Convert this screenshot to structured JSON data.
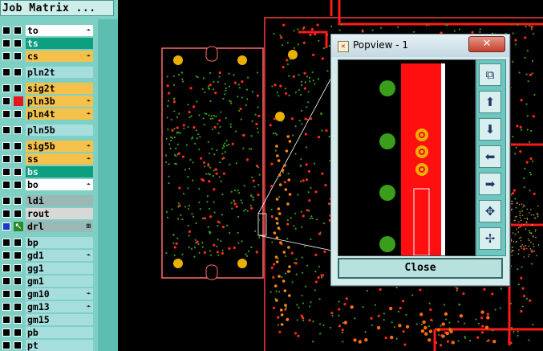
{
  "panel": {
    "title": "Job Matrix ..."
  },
  "layers": [
    {
      "name": "to",
      "color": "white",
      "mark": "⌁"
    },
    {
      "name": "ts",
      "color": "teal",
      "mark": ""
    },
    {
      "name": "cs",
      "color": "orange",
      "mark": "⌁"
    },
    {
      "name": "pln2t",
      "color": "cyan",
      "mark": ""
    },
    {
      "name": "sig2t",
      "color": "orange",
      "mark": ""
    },
    {
      "name": "pln3b",
      "color": "orange",
      "mark": "⌁",
      "active": true
    },
    {
      "name": "pln4t",
      "color": "orange",
      "mark": "⌁"
    },
    {
      "name": "pln5b",
      "color": "cyan",
      "mark": ""
    },
    {
      "name": "sig5b",
      "color": "orange",
      "mark": "⌁"
    },
    {
      "name": "ss",
      "color": "orange",
      "mark": "⌁"
    },
    {
      "name": "bs",
      "color": "teal",
      "mark": ""
    },
    {
      "name": "bo",
      "color": "white",
      "mark": "⌁"
    },
    {
      "name": "ldi",
      "color": "slate",
      "mark": ""
    },
    {
      "name": "rout",
      "color": "grey",
      "mark": ""
    },
    {
      "name": "drl",
      "color": "slate",
      "mark": "⊞",
      "selected": true
    },
    {
      "name": "bp",
      "color": "cyan",
      "mark": ""
    },
    {
      "name": "gd1",
      "color": "cyan",
      "mark": "⌁"
    },
    {
      "name": "gg1",
      "color": "cyan",
      "mark": ""
    },
    {
      "name": "gm1",
      "color": "cyan",
      "mark": ""
    },
    {
      "name": "gm10",
      "color": "cyan",
      "mark": "⌁"
    },
    {
      "name": "gm13",
      "color": "cyan",
      "mark": "⌁"
    },
    {
      "name": "gm15",
      "color": "cyan",
      "mark": ""
    },
    {
      "name": "pb",
      "color": "cyan",
      "mark": ""
    },
    {
      "name": "pt",
      "color": "cyan",
      "mark": ""
    }
  ],
  "popview": {
    "title": "Popview - 1",
    "close_x": "✕",
    "close_button": "Close",
    "tools": [
      "zoom-window-icon",
      "pan-up-icon",
      "pan-down-icon",
      "pan-left-icon",
      "pan-right-icon",
      "zoom-fit-icon",
      "zoom-home-icon"
    ]
  },
  "colors": {
    "trace": "#ff1a1a",
    "pad": "#e8b000",
    "via": "#3a9e1a",
    "outline": "#ff6a6a"
  }
}
